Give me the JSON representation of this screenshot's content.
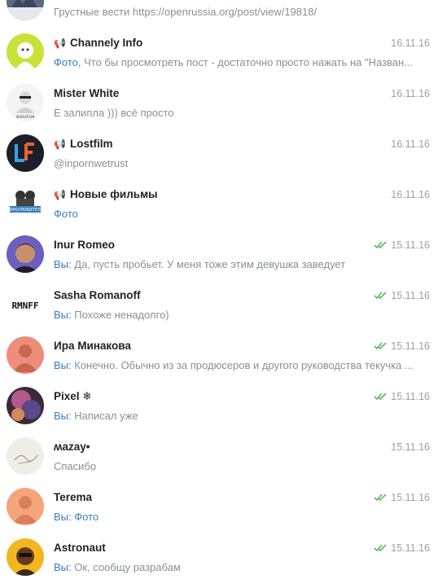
{
  "chats": [
    {
      "name": "",
      "date": "",
      "prefix": "",
      "text": "Грустные вести https://openrussia.org/post/view/19818/"
    },
    {
      "name": "Channely Info",
      "channel": true,
      "date": "16.11.16",
      "prefix": "Фото,",
      "text": " Что бы просмотреть пост - достаточно просто нажать на \"Назван..."
    },
    {
      "name": "Mister White",
      "date": "16.11.16",
      "prefix": "",
      "text": "Е залипла ))) всё просто"
    },
    {
      "name": "Lostfilm",
      "channel": true,
      "date": "16.11.16",
      "prefix": "",
      "text": "@inpornwetrust"
    },
    {
      "name": "Новые фильмы",
      "channel": true,
      "date": "16.11.16",
      "prefix": "Фото",
      "text": ""
    },
    {
      "name": "Inur Romeo",
      "date": "15.11.16",
      "read": true,
      "prefix": "Вы:",
      "text": " Да,  пусть пробьет. У меня тоже этим девушка заведует"
    },
    {
      "name": "Sasha Romanoff",
      "date": "15.11.16",
      "read": true,
      "prefix": "Вы:",
      "text": " Похоже ненадолго)"
    },
    {
      "name": "Ира Минакова",
      "date": "15.11.16",
      "read": true,
      "prefix": "Вы:",
      "text": " Конечно. Обычно из за продюсеров и другого руководства текучка ..."
    },
    {
      "name": "Pixel ❄",
      "date": "15.11.16",
      "read": true,
      "prefix": "Вы:",
      "text": " Написал уже"
    },
    {
      "name": "ʍazay•",
      "date": "15.11.16",
      "prefix": "",
      "text": "Спасибо"
    },
    {
      "name": "Terema",
      "date": "15.11.16",
      "read": true,
      "prefix": "Вы: Фото",
      "text": ""
    },
    {
      "name": "Astronaut",
      "date": "15.11.16",
      "read": true,
      "prefix": "Вы:",
      "text": " Ок,  сообщу разрабам"
    }
  ],
  "avatar_text": {
    "sasha": "RMNFF",
    "kino": "КИНОЛЮБИТЕЛИ",
    "white": "SENSATION"
  },
  "colors": {
    "accent": "#3a7dbf",
    "read_check": "#5cb85c",
    "muted": "#9aa0a6"
  },
  "icons": {
    "channel": "megaphone-icon",
    "read": "double-check-icon"
  }
}
